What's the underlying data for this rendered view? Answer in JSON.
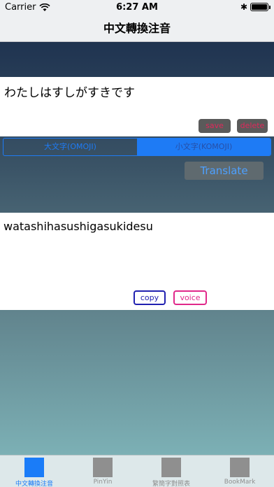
{
  "status": {
    "carrier": "Carrier",
    "time": "6:27 AM",
    "battery_level": 1.0
  },
  "nav": {
    "title": "中文轉換注音"
  },
  "input": {
    "text": "わたしはすしがすきです"
  },
  "buttons": {
    "save": "save",
    "delete": "delete",
    "translate": "Translate",
    "copy": "copy",
    "voice": "voice"
  },
  "segments": [
    {
      "label": "大文字(OMOJI)",
      "selected": false
    },
    {
      "label": "小文字(KOMOJI)",
      "selected": true
    }
  ],
  "output": {
    "text": "watashihasushigasukidesu"
  },
  "tabs": [
    {
      "label": "中文轉換注音",
      "active": true
    },
    {
      "label": "PinYin",
      "active": false
    },
    {
      "label": "繁簡字對照表",
      "active": false
    },
    {
      "label": "BookMark",
      "active": false
    }
  ],
  "colors": {
    "accent": "#1a7cf8",
    "nav_dark": "#1f3350",
    "teal_bottom": "#7cb0b5"
  }
}
